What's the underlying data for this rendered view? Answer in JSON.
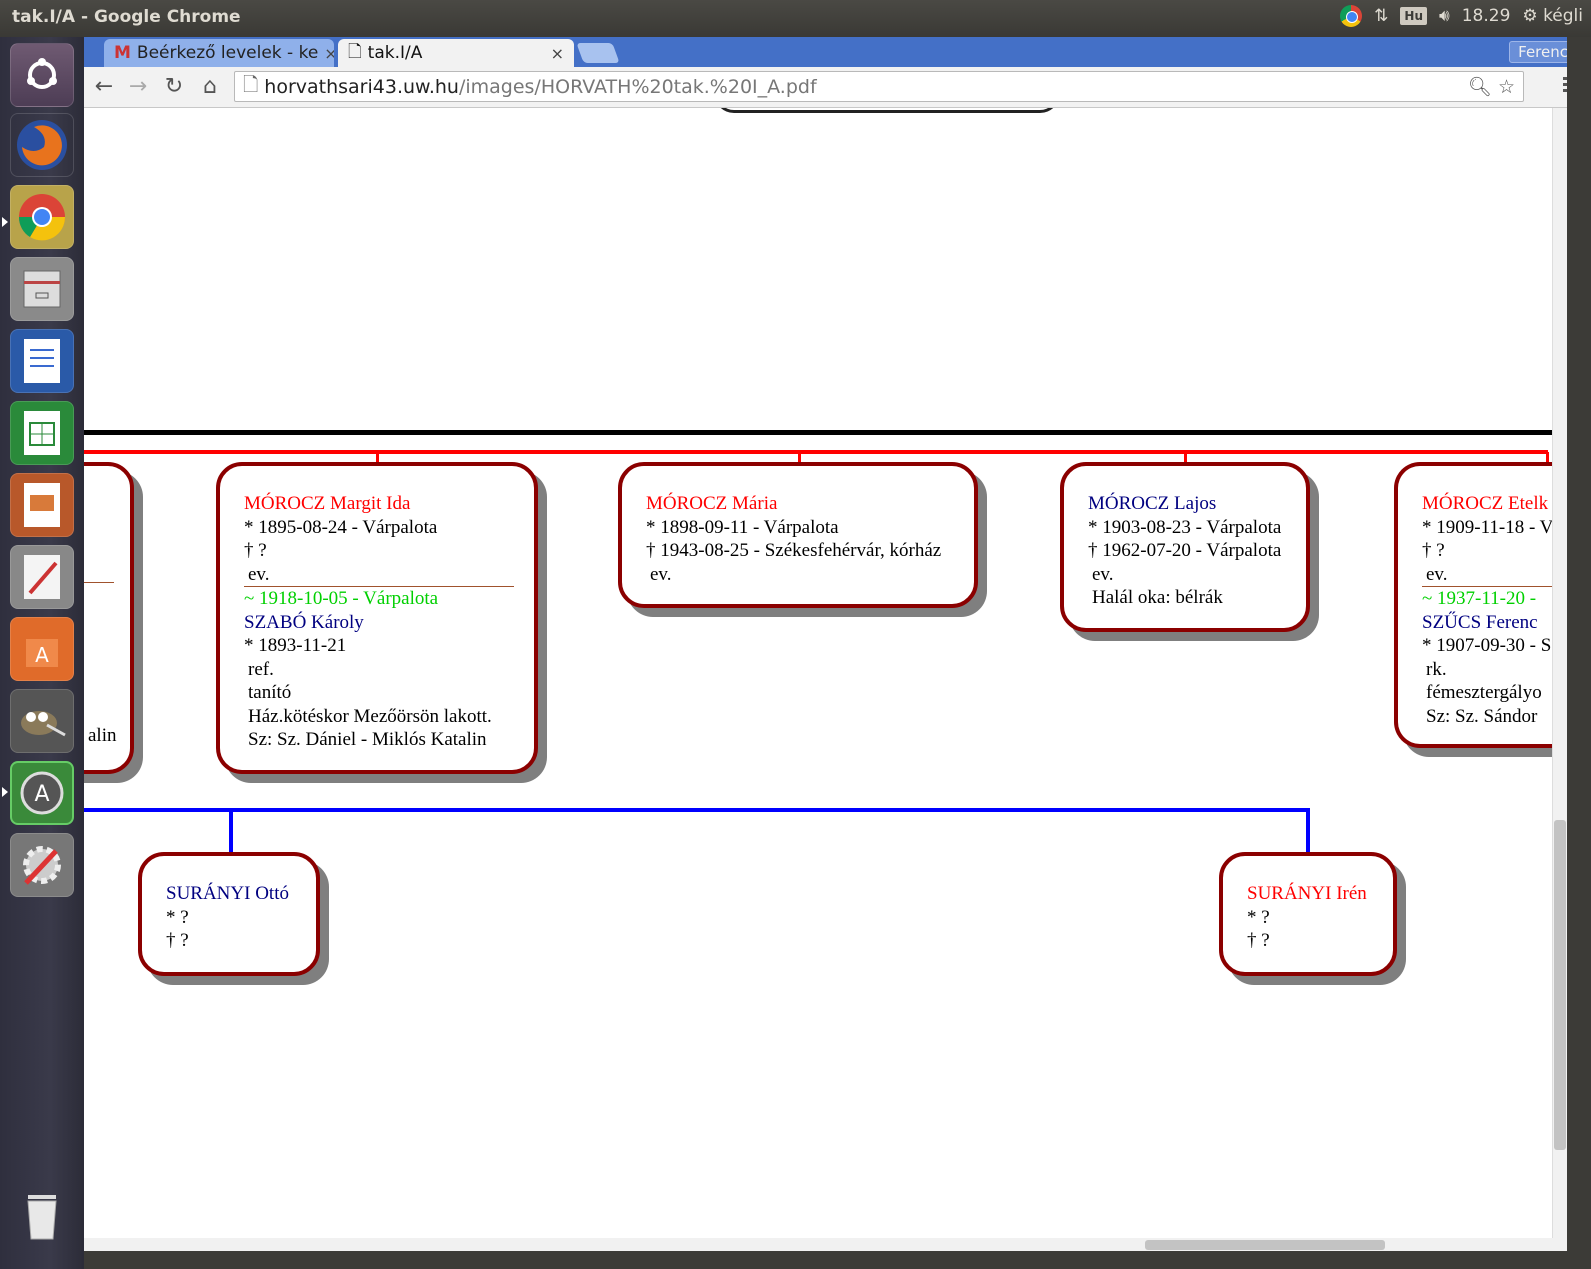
{
  "window": {
    "title": "tak.I/A - Google Chrome"
  },
  "tray": {
    "lang": "Hu",
    "time": "18.29",
    "session": "kégli"
  },
  "launcher": {
    "items": [
      "ubuntu-dash",
      "firefox",
      "chrome",
      "files",
      "writer",
      "calc",
      "impress",
      "text-editor",
      "software-center",
      "gimp",
      "update-manager",
      "system-settings",
      "trash"
    ]
  },
  "tabs": [
    {
      "label": "Beérkező levelek - ke",
      "close": "×"
    },
    {
      "label": "tak.I/A",
      "close": "×"
    }
  ],
  "profile": "Ferenc",
  "omnibox": {
    "host": "horvathsari43.uw.hu",
    "path": "/images/HORVATH%20tak.%20I_A.pdf"
  },
  "colors": {
    "female": "#ff0000",
    "male": "#000080",
    "marriage": "#00d000",
    "border": "#8b0000",
    "sibling_line": "#ff0000",
    "child_line": "#0000ff"
  },
  "tree": {
    "card0": {
      "partial": "alin"
    },
    "card1": {
      "name": "MÓROCZ Margit Ida",
      "birth": "* 1895-08-24 - Várpalota",
      "death": "† ?",
      "religion": "ev.",
      "marriage": "~ 1918-10-05 - Várpalota",
      "spouse": {
        "name": "SZABÓ Károly",
        "birth": "* 1893-11-21",
        "religion": "ref.",
        "occupation": "tanító",
        "note": "Ház.kötéskor Mezőörsön lakott.",
        "parents": "Sz: Sz. Dániel - Miklós Katalin"
      }
    },
    "card2": {
      "name": "MÓROCZ Mária",
      "birth": "* 1898-09-11 - Várpalota",
      "death": "† 1943-08-25 - Székesfehérvár, kórház",
      "religion": "ev."
    },
    "card3": {
      "name": "MÓROCZ Lajos",
      "birth": "* 1903-08-23 - Várpalota",
      "death": "† 1962-07-20 - Várpalota",
      "religion": "ev.",
      "cause": "Halál oka: bélrák"
    },
    "card4": {
      "name": "MÓROCZ Etelk",
      "birth": "* 1909-11-18 - V",
      "death": "† ?",
      "religion": "ev.",
      "marriage": "~ 1937-11-20 -",
      "spouse": {
        "name": "SZŰCS Ferenc",
        "birth": "* 1907-09-30 - S",
        "religion": "rk.",
        "occupation": "fémesztergályo",
        "parents": "Sz: Sz. Sándor"
      }
    },
    "child1": {
      "name": "SURÁNYI Ottó",
      "birth": "* ?",
      "death": "† ?"
    },
    "child2": {
      "name": "SURÁNYI Irén",
      "birth": "* ?",
      "death": "† ?"
    }
  }
}
